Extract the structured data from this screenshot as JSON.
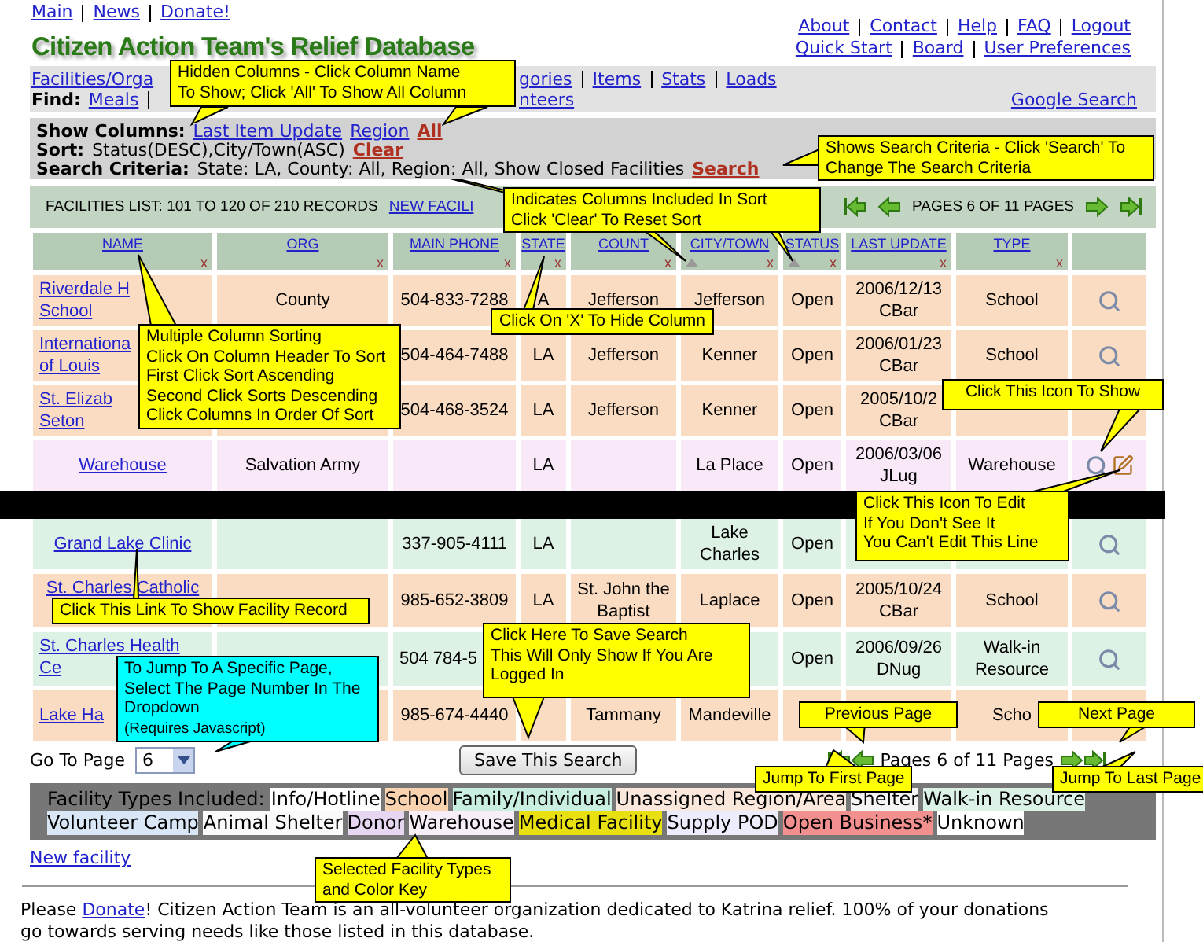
{
  "top_links": [
    "Main",
    "News",
    "Donate!"
  ],
  "logo": "Citizen Action Team's Relief Database",
  "account_links": [
    [
      "About",
      "Contact",
      "Help",
      "FAQ",
      "Logout"
    ],
    [
      "Quick Start",
      "Board",
      "User Preferences"
    ]
  ],
  "nav": {
    "menu": [
      "Facilities/Orga",
      "gories",
      "Items",
      "Stats",
      "Loads"
    ],
    "find_label": "Find:",
    "find_links": [
      "Meals",
      "nteers"
    ],
    "google": "Google Search"
  },
  "options": {
    "show_label": "Show Columns:",
    "hidden_columns": [
      "Last Item Update",
      "Region"
    ],
    "all": "All",
    "sort_label": "Sort:",
    "sort": "Status(DESC),City/Town(ASC)",
    "clear": "Clear",
    "criteria_label": "Search Criteria:",
    "criteria": "State: LA, County: All, Region: All, Show Closed Facilities",
    "search": "Search"
  },
  "list": {
    "title": "FACILITIES LIST: 101 TO 120 OF 210 RECORDS",
    "new_link": "NEW FACILI",
    "pages": "PAGES 6 OF 11 PAGES"
  },
  "table": {
    "columns": [
      {
        "label": "NAME",
        "hide": "x",
        "sorted": false
      },
      {
        "label": "ORG",
        "hide": "x",
        "sorted": false
      },
      {
        "label": "MAIN PHONE",
        "hide": "x",
        "sorted": false
      },
      {
        "label": "STATE",
        "hide": "x",
        "sorted": false
      },
      {
        "label": "COUNT",
        "hide": "x",
        "sorted": false
      },
      {
        "label": "CITY/TOWN",
        "hide": "x",
        "sorted": true
      },
      {
        "label": "STATUS",
        "hide": "x",
        "sorted": true
      },
      {
        "label": "LAST UPDATE",
        "hide": "x",
        "sorted": false
      },
      {
        "label": "TYPE",
        "hide": "x",
        "sorted": false
      }
    ],
    "rows": [
      {
        "color": "#f9dcc2",
        "name": [
          "Riverdale H",
          "School"
        ],
        "org": "County",
        "phone": "504-833-7288",
        "state": "A",
        "county": "Jefferson",
        "city": "Jefferson",
        "status": "Open",
        "updated": "2006/12/13",
        "by": "CBar",
        "type": "School",
        "view": true,
        "edit": false
      },
      {
        "color": "#f9dcc2",
        "name": [
          "Internationa",
          "of Louis"
        ],
        "phone": "504-464-7488",
        "state": "LA",
        "county": "Jefferson",
        "city": "Kenner",
        "status": "Open",
        "updated": "2006/01/23",
        "by": "CBar",
        "type": "School",
        "view": true,
        "edit": false
      },
      {
        "color": "#f9dcc2",
        "name": [
          "St. Elizab",
          "Seton"
        ],
        "phone": "504-468-3524",
        "state": "LA",
        "county": "Jefferson",
        "city": "Kenner",
        "status": "Open",
        "updated": "2005/10/2",
        "by": "CBar",
        "view": false,
        "edit": false
      },
      {
        "color": "#f8e8f8",
        "name": [
          "Warehouse"
        ],
        "org": "Salvation Army",
        "state": "LA",
        "city": "La Place",
        "status": "Open",
        "updated": "2006/03/06",
        "by": "JLug",
        "type": "Warehouse",
        "view": true,
        "edit": true
      },
      {
        "color": "#ddf1e5",
        "name": [
          "Grand Lake Clinic"
        ],
        "phone": "337-905-4111",
        "state": "LA",
        "city": "Lake Charles",
        "status": "Open",
        "view": true,
        "edit": false
      },
      {
        "color": "#f9dcc2",
        "name": [
          "St. Charles Catholic"
        ],
        "phone": "985-652-3809",
        "state": "LA",
        "county": "St. John the Baptist",
        "city": "Laplace",
        "status": "Open",
        "updated": "2005/10/24",
        "by": "CBar",
        "type": "School",
        "view": true,
        "edit": false
      },
      {
        "color": "#ddf1e5",
        "name": [
          "St. Charles Health",
          "Ce"
        ],
        "phone": "504 784-5",
        "status": "Open",
        "updated": "2006/09/26",
        "by": "DNug",
        "type": "Walk-in Resource",
        "view": true,
        "edit": false
      },
      {
        "color": "#f9dcc2",
        "name": [
          "Lake Ha"
        ],
        "phone": "985-674-4440",
        "county": "Tammany",
        "city": "Mandeville",
        "type": "Scho",
        "view": false,
        "edit": false
      }
    ]
  },
  "pager": {
    "go_to_label": "Go To Page",
    "page_select": "6",
    "save_button": "Save This Search",
    "pages": "Pages 6 of 11 Pages"
  },
  "facility_types": {
    "label": "Facility Types Included:",
    "items": [
      {
        "label": "Info/Hotline",
        "color": "#ffffff"
      },
      {
        "label": "School",
        "color": "#f9d2b0"
      },
      {
        "label": "Family/Individual",
        "color": "#c8efe0"
      },
      {
        "label": "Unassigned Region/Area",
        "color": "#fbe8dc"
      },
      {
        "label": "Shelter",
        "color": "#f4f4f4"
      },
      {
        "label": "Walk-in Resource",
        "color": "#ddf2e6"
      },
      {
        "label": "Volunteer Camp",
        "color": "#d8e6f6"
      },
      {
        "label": "Animal Shelter",
        "color": "#fafafa"
      },
      {
        "label": "Donor",
        "color": "#e6d6f2"
      },
      {
        "label": "Warehouse",
        "color": "#f8eef8"
      },
      {
        "label": "Medical Facility",
        "color": "#e8e010"
      },
      {
        "label": "Supply POD",
        "color": "#ececfc"
      },
      {
        "label": "Open Business*",
        "color": "#f29090"
      },
      {
        "label": "Unknown",
        "color": "#ffffff"
      }
    ]
  },
  "new_facility": "New facility",
  "footer": {
    "before": "Please ",
    "link": "Donate",
    "after": "! Citizen Action Team is an all-volunteer organization dedicated to Katrina relief. 100% of your donations go towards serving needs like those listed in this database."
  },
  "callouts": [
    {
      "text": "Hidden Columns - Click Column Name\nTo Show; Click 'All' To Show All Column",
      "color": "#ffff00"
    },
    {
      "text": "Shows Search Criteria - Click 'Search' To\nChange The Search Criteria",
      "color": "#ffff00"
    },
    {
      "text": "Indicates Columns Included In Sort\nClick 'Clear' To Reset Sort",
      "color": "#ffff00"
    },
    {
      "text": "Multiple Column Sorting\nClick On Column Header To Sort\nFirst Click Sort Ascending\nSecond Click Sorts Descending\nClick Columns In Order Of Sort",
      "color": "#ffff00"
    },
    {
      "text": "Click On 'X' To Hide Column",
      "color": "#ffff00"
    },
    {
      "text": "Click This Icon To Show",
      "color": "#ffff00"
    },
    {
      "text": "Click This Icon To Edit\nIf You Don't See It\nYou Can't Edit This Line",
      "color": "#ffff00"
    },
    {
      "text": "Click This Link To Show Facility Record",
      "color": "#ffff00"
    },
    {
      "text": "To Jump To A Specific Page,\nSelect The Page Number In The\nDropdown",
      "note": "(Requires Javascript)",
      "color": "#00ffff"
    },
    {
      "text": "Click Here To Save Search\nThis Will Only Show If You Are\nLogged In",
      "color": "#ffff00"
    },
    {
      "text": "Previous Page",
      "color": "#ffff00"
    },
    {
      "text": "Next Page",
      "color": "#ffff00"
    },
    {
      "text": "Jump To First Page",
      "color": "#ffff00"
    },
    {
      "text": "Jump To Last Page",
      "color": "#ffff00"
    },
    {
      "text": "Selected Facility Types\nand Color Key",
      "color": "#ffff00"
    }
  ]
}
